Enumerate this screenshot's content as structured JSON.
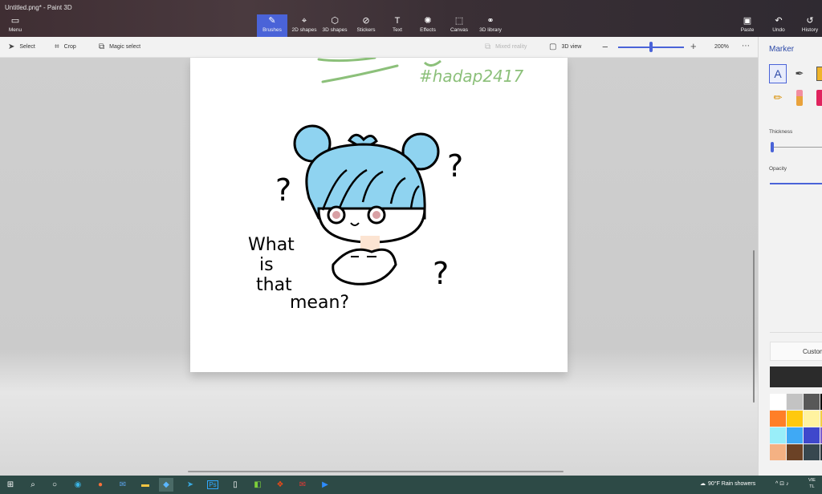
{
  "app": {
    "title": "Untitled.png* - Paint 3D"
  },
  "ribbon": {
    "menu": "Menu",
    "tabs": [
      {
        "label": "Brushes",
        "icon": "brush-icon",
        "active": true
      },
      {
        "label": "2D shapes",
        "icon": "2d-shapes-icon"
      },
      {
        "label": "3D shapes",
        "icon": "3d-shapes-icon"
      },
      {
        "label": "Stickers",
        "icon": "stickers-icon"
      },
      {
        "label": "Text",
        "icon": "text-icon"
      },
      {
        "label": "Effects",
        "icon": "effects-icon"
      },
      {
        "label": "Canvas",
        "icon": "canvas-icon"
      },
      {
        "label": "3D library",
        "icon": "3d-library-icon"
      }
    ],
    "paste": "Paste",
    "undo": "Undo",
    "history": "History"
  },
  "cmdbar": {
    "select": "Select",
    "crop": "Crop",
    "magic_select": "Magic select",
    "mixed_reality": "Mixed reality",
    "view_3d": "3D view",
    "zoom_percent": 50,
    "zoom": "200%"
  },
  "canvas": {
    "hashtag": "#hadap2417",
    "q1": "?",
    "q2": "?",
    "q3": "?",
    "line1": "What",
    "line2": "is",
    "line3": "that",
    "line4": "mean?"
  },
  "panel": {
    "title": "Marker",
    "thickness_label": "Thickness",
    "opacity_label": "Opacity",
    "custom": "Custom",
    "thickness_value": 0.02,
    "opacity_value": 1.0,
    "current_color": "#2b2b2b"
  },
  "swatches": [
    [
      "#ffffff",
      "#c3c3c3",
      "#585858",
      "#000000"
    ],
    [
      "#ff7f27",
      "#ffc90e",
      "#fff3a0",
      "#f4d03f"
    ],
    [
      "#99eef9",
      "#3fa9f5",
      "#3f48cc",
      "#7a5ccf"
    ],
    [
      "#f4b183",
      "#6b4226",
      "#37474f",
      "#263238"
    ]
  ],
  "taskbar": {
    "weather": "90°F  Rain showers",
    "lang1": "VIE",
    "lang2": "TL"
  }
}
